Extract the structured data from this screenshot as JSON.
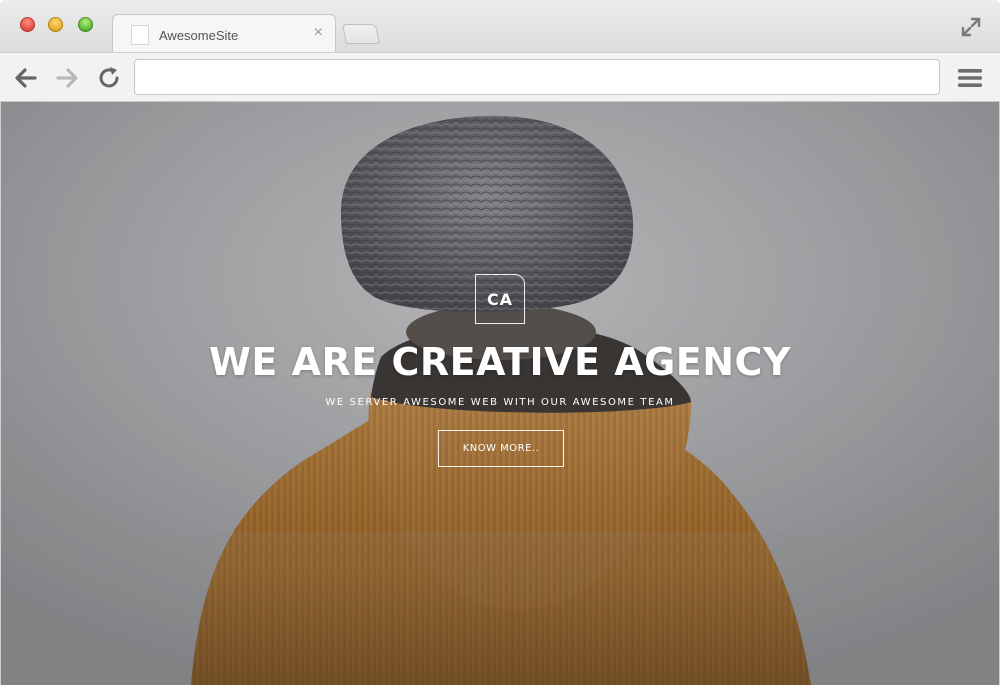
{
  "browser": {
    "tab": {
      "title": "AwesomeSite",
      "close_glyph": "×"
    },
    "address_bar": {
      "value": "",
      "placeholder": ""
    },
    "icons": {
      "back": "arrow-left-icon",
      "forward": "arrow-right-icon",
      "reload": "reload-icon",
      "menu": "hamburger-menu-icon",
      "fullscreen": "fullscreen-icon"
    },
    "colors": {
      "close": "#e0443a",
      "minimize": "#e3a21a",
      "zoom": "#4cae2a"
    }
  },
  "hero": {
    "logo": "CA",
    "headline": "WE ARE CREATIVE AGENCY",
    "subheadline": "WE SERVER AWESOME WEB WITH OUR AWESOME TEAM",
    "cta_label": "KNOW MORE..",
    "colors": {
      "jacket": "#a8722f",
      "beanie": "#6f6f73",
      "background": "#a7a8ab"
    }
  }
}
